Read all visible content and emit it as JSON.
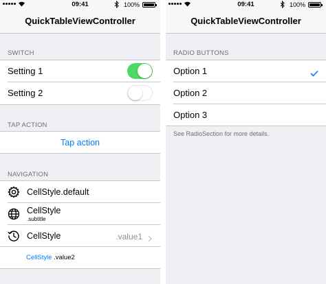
{
  "status": {
    "time": "09:41",
    "battery": "100%",
    "battery_level": 1.0
  },
  "left": {
    "title": "QuickTableViewController",
    "switch_section": {
      "header": "SWITCH",
      "rows": [
        {
          "label": "Setting 1",
          "on": true
        },
        {
          "label": "Setting 2",
          "on": false
        }
      ]
    },
    "tap_section": {
      "header": "TAP ACTION",
      "button": "Tap action"
    },
    "navigation_section": {
      "header": "NAVIGATION",
      "rows": [
        {
          "icon": "gear-icon",
          "title": "CellStyle.default"
        },
        {
          "icon": "globe-icon",
          "title": "CellStyle",
          "subtitle": ".subtitle"
        },
        {
          "icon": "history-icon",
          "title": "CellStyle",
          "detail": ".value1"
        }
      ],
      "value2": {
        "title": "CellStyle",
        "detail": ".value2"
      }
    }
  },
  "right": {
    "title": "QuickTableViewController",
    "radio_section": {
      "header": "RADIO BUTTONS",
      "options": [
        {
          "label": "Option 1",
          "selected": true
        },
        {
          "label": "Option 2",
          "selected": false
        },
        {
          "label": "Option 3",
          "selected": false
        }
      ],
      "footer": "See RadioSection for more details."
    }
  },
  "colors": {
    "accent": "#007aff",
    "switch_on": "#4cd964",
    "background": "#efeff4"
  }
}
